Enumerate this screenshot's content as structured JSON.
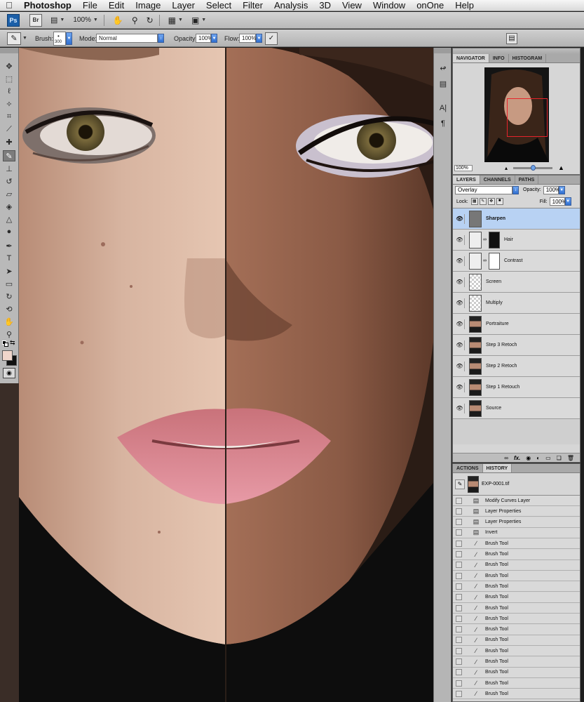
{
  "menubar": {
    "app": "Photoshop",
    "items": [
      "File",
      "Edit",
      "Image",
      "Layer",
      "Select",
      "Filter",
      "Analysis",
      "3D",
      "View",
      "Window",
      "onOne",
      "Help"
    ]
  },
  "appbar": {
    "ps_logo": "Ps",
    "br_logo": "Br",
    "zoom": "100%"
  },
  "options": {
    "brush_label": "Brush:",
    "brush_size": "300",
    "mode_label": "Mode:",
    "mode_value": "Normal",
    "opacity_label": "Opacity:",
    "opacity_value": "100%",
    "flow_label": "Flow:",
    "flow_value": "100%"
  },
  "navigator": {
    "tabs": [
      "NAVIGATOR",
      "INFO",
      "HISTOGRAM"
    ],
    "zoom": "100%"
  },
  "layers": {
    "tabs": [
      "LAYERS",
      "CHANNELS",
      "PATHS"
    ],
    "blend_mode": "Overlay",
    "opacity_label": "Opacity:",
    "opacity_value": "100%",
    "lock_label": "Lock:",
    "fill_label": "Fill:",
    "fill_value": "100%",
    "items": [
      {
        "name": "Sharpen",
        "thumb": "gray",
        "mask": false,
        "selected": true
      },
      {
        "name": "Hair",
        "thumb": "curve",
        "mask": "black",
        "selected": false
      },
      {
        "name": "Contrast",
        "thumb": "curve",
        "mask": "white",
        "selected": false
      },
      {
        "name": "Screen",
        "thumb": "trans",
        "mask": false,
        "selected": false
      },
      {
        "name": "Multiply",
        "thumb": "trans",
        "mask": false,
        "selected": false
      },
      {
        "name": "Portraiture",
        "thumb": "photo",
        "mask": false,
        "selected": false
      },
      {
        "name": "Step 3 Retoch",
        "thumb": "photo",
        "mask": false,
        "selected": false
      },
      {
        "name": "Step 2 Retoch",
        "thumb": "photo",
        "mask": false,
        "selected": false
      },
      {
        "name": "Step 1 Retouch",
        "thumb": "photo",
        "mask": false,
        "selected": false
      },
      {
        "name": "Source",
        "thumb": "photo",
        "mask": false,
        "selected": false
      }
    ],
    "footer_fx": "fx."
  },
  "history": {
    "tabs": [
      "ACTIONS",
      "HISTORY"
    ],
    "snapshot": "EXP-0001.tif",
    "items": [
      {
        "label": "Modify Curves Layer",
        "icon": "doc"
      },
      {
        "label": "Layer Properties",
        "icon": "doc"
      },
      {
        "label": "Layer Properties",
        "icon": "doc"
      },
      {
        "label": "Invert",
        "icon": "doc"
      },
      {
        "label": "Brush Tool",
        "icon": "brush"
      },
      {
        "label": "Brush Tool",
        "icon": "brush"
      },
      {
        "label": "Brush Tool",
        "icon": "brush"
      },
      {
        "label": "Brush Tool",
        "icon": "brush"
      },
      {
        "label": "Brush Tool",
        "icon": "brush"
      },
      {
        "label": "Brush Tool",
        "icon": "brush"
      },
      {
        "label": "Brush Tool",
        "icon": "brush"
      },
      {
        "label": "Brush Tool",
        "icon": "brush"
      },
      {
        "label": "Brush Tool",
        "icon": "brush"
      },
      {
        "label": "Brush Tool",
        "icon": "brush"
      },
      {
        "label": "Brush Tool",
        "icon": "brush"
      },
      {
        "label": "Brush Tool",
        "icon": "brush"
      },
      {
        "label": "Brush Tool",
        "icon": "brush"
      },
      {
        "label": "Brush Tool",
        "icon": "brush"
      },
      {
        "label": "Brush Tool",
        "icon": "brush"
      }
    ]
  },
  "tools": [
    {
      "name": "move-tool-icon",
      "glyph": "✥"
    },
    {
      "name": "marquee-tool-icon",
      "glyph": "⬚"
    },
    {
      "name": "lasso-tool-icon",
      "glyph": "ℓ"
    },
    {
      "name": "magic-wand-tool-icon",
      "glyph": "✧"
    },
    {
      "name": "crop-tool-icon",
      "glyph": "⌗"
    },
    {
      "name": "eyedropper-tool-icon",
      "glyph": "⟋"
    },
    {
      "name": "healing-brush-tool-icon",
      "glyph": "✚"
    },
    {
      "name": "brush-tool-icon",
      "glyph": "✎"
    },
    {
      "name": "clone-stamp-tool-icon",
      "glyph": "⊥"
    },
    {
      "name": "history-brush-tool-icon",
      "glyph": "↺"
    },
    {
      "name": "eraser-tool-icon",
      "glyph": "▱"
    },
    {
      "name": "paint-bucket-tool-icon",
      "glyph": "◈"
    },
    {
      "name": "blur-tool-icon",
      "glyph": "△"
    },
    {
      "name": "dodge-tool-icon",
      "glyph": "●"
    },
    {
      "name": "pen-tool-icon",
      "glyph": "✒"
    },
    {
      "name": "type-tool-icon",
      "glyph": "T"
    },
    {
      "name": "path-selection-tool-icon",
      "glyph": "➤"
    },
    {
      "name": "shape-tool-icon",
      "glyph": "▭"
    },
    {
      "name": "3d-rotate-tool-icon",
      "glyph": "↻"
    },
    {
      "name": "3d-orbit-tool-icon",
      "glyph": "⟲"
    },
    {
      "name": "hand-tool-icon",
      "glyph": "✋"
    },
    {
      "name": "zoom-tool-icon",
      "glyph": "⚲"
    }
  ],
  "colors": {
    "selected_layer": "#b8d2f3",
    "navigator_box": "#e6242b",
    "foreground_swatch": "#f0d6cb",
    "background_swatch": "#111111"
  }
}
